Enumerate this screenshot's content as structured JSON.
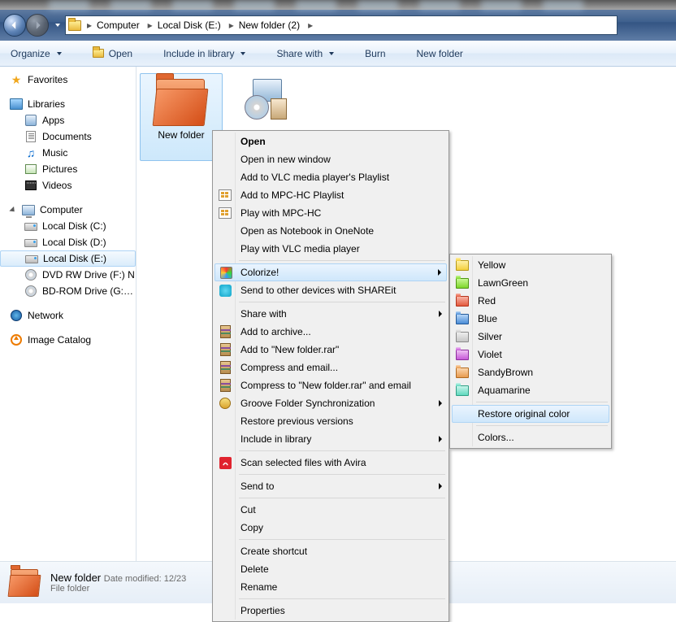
{
  "breadcrumbs": [
    "Computer",
    "Local Disk (E:)",
    "New folder (2)"
  ],
  "toolbar": {
    "organize": "Organize",
    "open": "Open",
    "include": "Include in library",
    "share": "Share with",
    "burn": "Burn",
    "newfolder": "New folder"
  },
  "sidebar": {
    "favorites": "Favorites",
    "libraries": "Libraries",
    "lib_items": [
      "Apps",
      "Documents",
      "Music",
      "Pictures",
      "Videos"
    ],
    "computer": "Computer",
    "drives": [
      "Local Disk (C:)",
      "Local Disk (D:)",
      "Local Disk (E:)",
      "DVD RW Drive (F:)  N",
      "BD-ROM Drive (G:) D"
    ],
    "network": "Network",
    "imagecatalog": "Image Catalog"
  },
  "files": {
    "sel_name": "New folder",
    "other_name": ""
  },
  "details": {
    "name": "New folder",
    "date_lbl": "Date modified:",
    "date_val": "12/23",
    "type": "File folder"
  },
  "contextmenu": [
    {
      "label": "Open",
      "bold": true
    },
    {
      "label": "Open in new window"
    },
    {
      "label": "Add to VLC media player's Playlist"
    },
    {
      "label": "Add to MPC-HC Playlist",
      "icon": "mpc"
    },
    {
      "label": "Play with MPC-HC",
      "icon": "mpc"
    },
    {
      "label": "Open as Notebook in OneNote"
    },
    {
      "label": "Play with VLC media player"
    },
    {
      "sep": true
    },
    {
      "label": "Colorize!",
      "icon": "colorize",
      "arrow": true,
      "hov": true
    },
    {
      "label": "Send to other devices with SHAREit",
      "icon": "shareit"
    },
    {
      "sep": true
    },
    {
      "label": "Share with",
      "arrow": true
    },
    {
      "label": "Add to archive...",
      "icon": "rar"
    },
    {
      "label": "Add to \"New folder.rar\"",
      "icon": "rar"
    },
    {
      "label": "Compress and email...",
      "icon": "rar"
    },
    {
      "label": "Compress to \"New folder.rar\" and email",
      "icon": "rar"
    },
    {
      "label": "Groove Folder Synchronization",
      "icon": "groove",
      "arrow": true
    },
    {
      "label": "Restore previous versions"
    },
    {
      "label": "Include in library",
      "arrow": true
    },
    {
      "sep": true
    },
    {
      "label": "Scan selected files with Avira",
      "icon": "avira"
    },
    {
      "sep": true
    },
    {
      "label": "Send to",
      "arrow": true
    },
    {
      "sep": true
    },
    {
      "label": "Cut"
    },
    {
      "label": "Copy"
    },
    {
      "sep": true
    },
    {
      "label": "Create shortcut"
    },
    {
      "label": "Delete"
    },
    {
      "label": "Rename"
    },
    {
      "sep": true
    },
    {
      "label": "Properties"
    }
  ],
  "submenu": {
    "colors": [
      {
        "label": "Yellow",
        "cls": "yellow"
      },
      {
        "label": "LawnGreen",
        "cls": "lawngreen"
      },
      {
        "label": "Red",
        "cls": "red"
      },
      {
        "label": "Blue",
        "cls": "blue"
      },
      {
        "label": "Silver",
        "cls": "silver"
      },
      {
        "label": "Violet",
        "cls": "violet"
      },
      {
        "label": "SandyBrown",
        "cls": "sandybrown"
      },
      {
        "label": "Aquamarine",
        "cls": "aquamarine"
      }
    ],
    "restore": "Restore original color",
    "colors_more": "Colors..."
  }
}
